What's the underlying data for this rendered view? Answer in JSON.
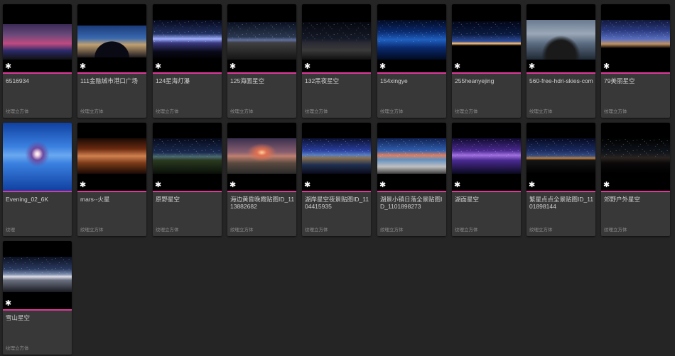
{
  "accent_color": "#e0389a",
  "assets": [
    {
      "name": "6516934",
      "type": "纹理立方体",
      "icon": "star-icon",
      "thumb": "city"
    },
    {
      "name": "111金融城市港口广场",
      "type": "纹理立方体",
      "icon": "star-icon",
      "thumb": "fisheye-city"
    },
    {
      "name": "124星海灯瀑",
      "type": "纹理立方体",
      "icon": "star-icon",
      "thumb": "milkyway"
    },
    {
      "name": "125海面星空",
      "type": "纹理立方体",
      "icon": "star-icon",
      "thumb": "sea-stars"
    },
    {
      "name": "132黑夜星空",
      "type": "纹理立方体",
      "icon": "star-icon",
      "thumb": "dark-stars"
    },
    {
      "name": "154xingye",
      "type": "纹理立方体",
      "icon": "star-icon",
      "thumb": "blue-reflect"
    },
    {
      "name": "255heanyejing",
      "type": "纹理立方体",
      "icon": "star-icon",
      "thumb": "night-horizon"
    },
    {
      "name": "560-free-hdri-skies-com",
      "type": "纹理立方体",
      "icon": "star-icon",
      "thumb": "cloudy"
    },
    {
      "name": "79美丽星空",
      "type": "纹理立方体",
      "icon": "star-icon",
      "thumb": "starry-blue"
    },
    {
      "name": "Evening_02_6K",
      "type": "纹理",
      "icon": "",
      "thumb": "evening"
    },
    {
      "name": "mars--火星",
      "type": "纹理立方体",
      "icon": "star-icon",
      "thumb": "mars"
    },
    {
      "name": "原野星空",
      "type": "纹理立方体",
      "icon": "star-icon",
      "thumb": "field"
    },
    {
      "name": "海边黄昏晚霞贴图ID_1113882682",
      "type": "纹理立方体",
      "icon": "star-icon",
      "thumb": "sunset-fisheye"
    },
    {
      "name": "湖岸星空夜景贴图ID_1104415935",
      "type": "纹理立方体",
      "icon": "star-icon",
      "thumb": "lake-shore"
    },
    {
      "name": "湖景小镇日落全景贴图ID_1101898273",
      "type": "纹理立方体",
      "icon": "star-icon",
      "thumb": "lake-sunset"
    },
    {
      "name": "湖面星空",
      "type": "纹理立方体",
      "icon": "star-icon",
      "thumb": "purple-lake"
    },
    {
      "name": "繁星点点全景贴图ID_1101898144",
      "type": "纹理立方体",
      "icon": "star-icon",
      "thumb": "starry-field"
    },
    {
      "name": "郊野户外星空",
      "type": "纹理立方体",
      "icon": "star-icon",
      "thumb": "dark-outdoor"
    },
    {
      "name": "雪山星空",
      "type": "纹理立方体",
      "icon": "star-icon",
      "thumb": "snow-mountain"
    }
  ]
}
